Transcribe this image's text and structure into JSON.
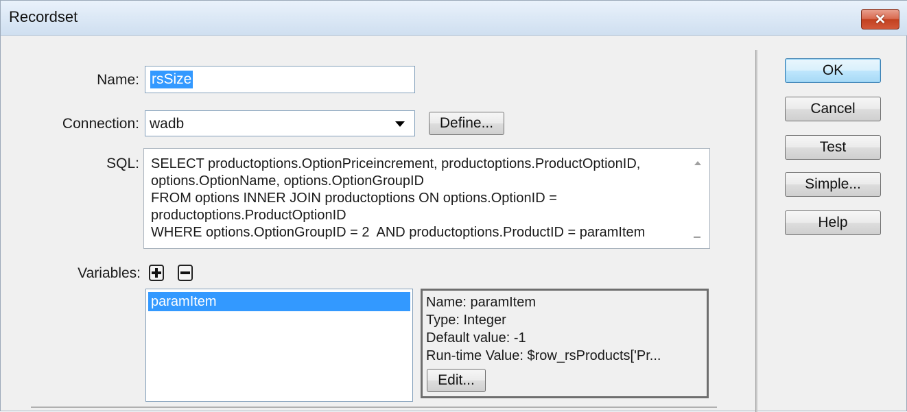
{
  "window": {
    "title": "Recordset",
    "close_symbol": "✕"
  },
  "form": {
    "name_label": "Name:",
    "name_value": "rsSize",
    "connection_label": "Connection:",
    "connection_value": "wadb",
    "define_button": "Define...",
    "sql_label": "SQL:",
    "sql_lines": [
      "SELECT productoptions.OptionPriceincrement, productoptions.ProductOptionID,",
      "options.OptionName, options.OptionGroupID",
      "FROM options INNER JOIN productoptions ON options.OptionID =",
      "productoptions.ProductOptionID",
      "WHERE options.OptionGroupID = 2  AND productoptions.ProductID = paramItem"
    ],
    "variables_label": "Variables:",
    "variables": [
      "paramItem"
    ],
    "details": {
      "name": "Name: paramItem",
      "type": "Type: Integer",
      "default": "Default value: -1",
      "runtime": "Run-time Value: $row_rsProducts['Pr...",
      "edit_button": "Edit..."
    }
  },
  "actions": {
    "ok": "OK",
    "cancel": "Cancel",
    "test": "Test",
    "simple": "Simple...",
    "help": "Help"
  },
  "icons": {
    "add": "plus-icon",
    "remove": "minus-icon",
    "dropdown": "chevron-down-icon",
    "close": "close-icon"
  },
  "colors": {
    "selection": "#3399ff",
    "close_button": "#c2401f"
  }
}
